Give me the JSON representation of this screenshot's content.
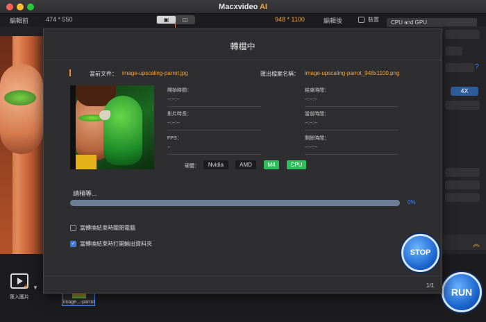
{
  "window": {
    "title_main": "Macxvideo",
    "title_accent": "AI"
  },
  "toolbar": {
    "before_label": "編輯前",
    "before_size": "474 * 550",
    "view_toggle_a": "▣",
    "view_toggle_b": "◫",
    "after_size": "948 * 1100",
    "after_label": "編輯後",
    "device_label": "裝置",
    "device_value": "CPU and GPU"
  },
  "right_panel": {
    "scale_option": "4X",
    "help": "?"
  },
  "dialog": {
    "title": "轉檔中",
    "current_file_label": "當前文件：",
    "current_file": "image-upscaling-parrot.jpg",
    "output_name_label": "匯出檔案名稱：",
    "output_name": "image-upscaling-parrot_948x1100.png",
    "fields": {
      "start_time_label": "開始時間：",
      "start_time": "--:--:--",
      "end_time_label": "結束時間：",
      "end_time": "--:--:--",
      "duration_label": "影片時長：",
      "duration": "--:--:--",
      "current_time_label": "當前時間：",
      "current_time": "--:--:--",
      "fps_label": "FPS：",
      "fps": "--",
      "remaining_label": "剩餘時間：",
      "remaining": "--:--:--"
    },
    "hardware_label": "硬體：",
    "hardware": [
      {
        "name": "Nvidia",
        "active": false
      },
      {
        "name": "AMD",
        "active": false
      },
      {
        "name": "M4",
        "active": true
      },
      {
        "name": "CPU",
        "active": true
      }
    ],
    "status": "請稍等...",
    "progress_percent": 0,
    "progress_text": "0%",
    "option_shutdown": {
      "label": "當轉換結束時關閉電腦",
      "checked": false
    },
    "option_open_folder": {
      "label": "當轉換結束時打開輸出資料夾",
      "checked": true
    },
    "stop_label": "STOP",
    "page_indicator": "1/1"
  },
  "bottom": {
    "import_label": "匯入圖片",
    "thumbnail_name": "image...-parrot",
    "run_label": "RUN"
  },
  "colors": {
    "accent": "#f2a53a",
    "blue": "#3d78d8",
    "green": "#2fbf5a"
  }
}
